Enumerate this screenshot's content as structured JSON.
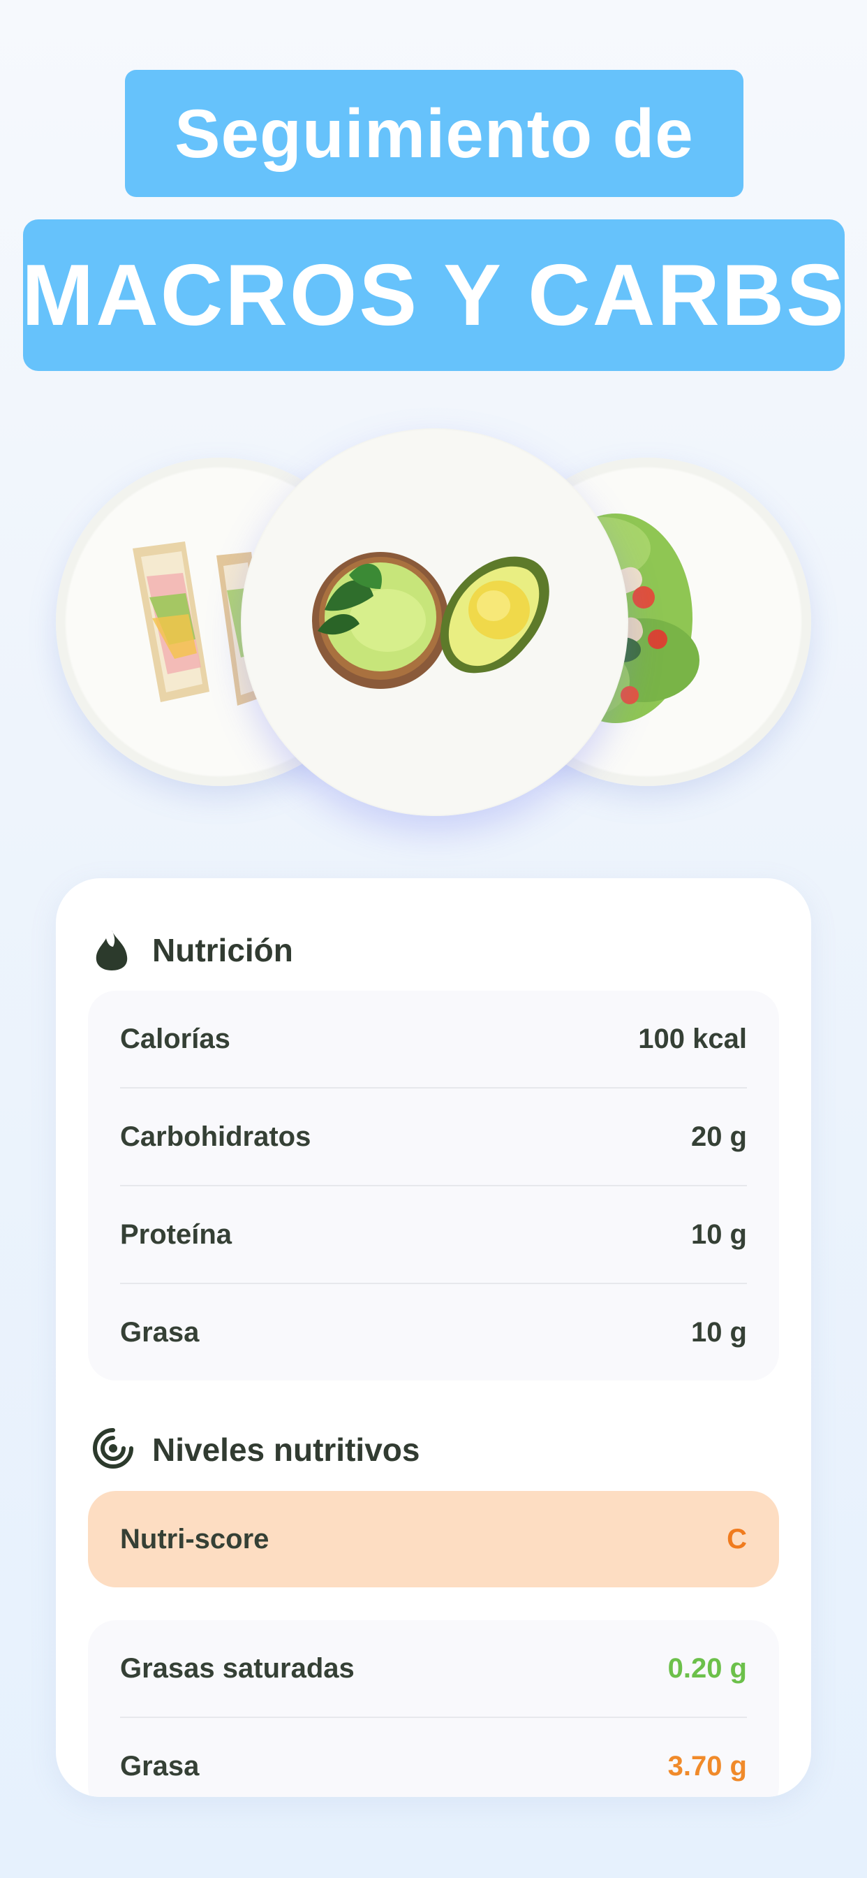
{
  "header": {
    "line1": "Seguimiento de",
    "line2": "MACROS Y CARBS"
  },
  "colors": {
    "banner": "#66c2fb",
    "nutri_score_bg": "#fdddc2",
    "nutri_score_value": "#f07b1e",
    "good_value": "#6cc04a",
    "warning_value": "#f08a2a"
  },
  "nutrition": {
    "title": "Nutrición",
    "icon": "flame-icon",
    "rows": [
      {
        "label": "Calorías",
        "value": "100 kcal"
      },
      {
        "label": "Carbohidratos",
        "value": "20 g"
      },
      {
        "label": "Proteína",
        "value": "10 g"
      },
      {
        "label": "Grasa",
        "value": "10 g"
      }
    ]
  },
  "levels": {
    "title": "Niveles nutritivos",
    "icon": "target-icon",
    "nutri_score": {
      "label": "Nutri-score",
      "value": "C"
    },
    "rows": [
      {
        "label": "Grasas saturadas",
        "value": "0.20 g"
      },
      {
        "label": "Grasa",
        "value": "3.70 g"
      }
    ]
  }
}
